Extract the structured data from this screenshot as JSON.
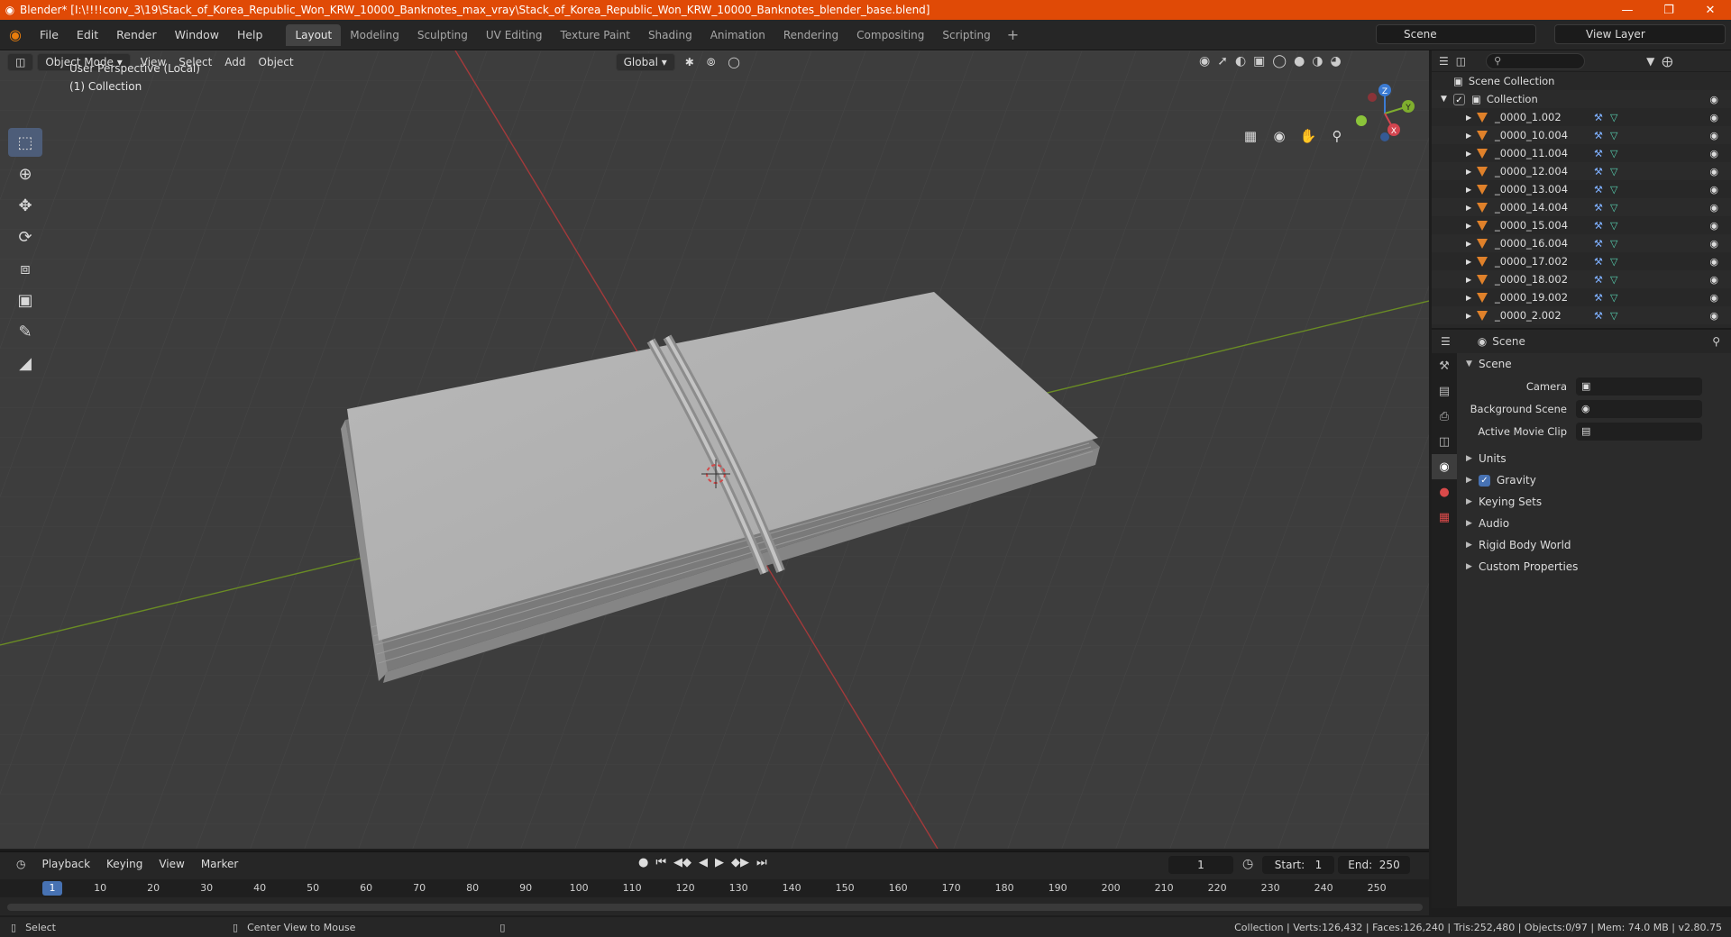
{
  "window": {
    "title": "Blender* [I:\\!!!!conv_3\\19\\Stack_of_Korea_Republic_Won_KRW_10000_Banknotes_max_vray\\Stack_of_Korea_Republic_Won_KRW_10000_Banknotes_blender_base.blend]",
    "minimize": "—",
    "maximize": "❐",
    "close": "✕"
  },
  "menu": [
    "File",
    "Edit",
    "Render",
    "Window",
    "Help"
  ],
  "workspaces": [
    "Layout",
    "Modeling",
    "Sculpting",
    "UV Editing",
    "Texture Paint",
    "Shading",
    "Animation",
    "Rendering",
    "Compositing",
    "Scripting"
  ],
  "workspace_add": "+",
  "scene_selector": "Scene",
  "view_layer": "View Layer",
  "viewport": {
    "mode": "Object Mode",
    "menus": [
      "View",
      "Select",
      "Add",
      "Object"
    ],
    "transform_orientation": "Global",
    "info_line1": "User Perspective (Local)",
    "info_line2": "(1) Collection",
    "gizmo_axes": {
      "x": "X",
      "y": "Y",
      "z": "Z"
    }
  },
  "outliner": {
    "root": "Scene Collection",
    "collection": "Collection",
    "objects": [
      "_0000_1.002",
      "_0000_10.004",
      "_0000_11.004",
      "_0000_12.004",
      "_0000_13.004",
      "_0000_14.004",
      "_0000_15.004",
      "_0000_16.004",
      "_0000_17.002",
      "_0000_18.002",
      "_0000_19.002",
      "_0000_2.002"
    ]
  },
  "properties": {
    "header": "Scene",
    "section": "Scene",
    "fields": [
      {
        "label": "Camera",
        "value": ""
      },
      {
        "label": "Background Scene",
        "value": ""
      },
      {
        "label": "Active Movie Clip",
        "value": ""
      }
    ],
    "panels": [
      "Units",
      "Gravity",
      "Keying Sets",
      "Audio",
      "Rigid Body World",
      "Custom Properties"
    ],
    "gravity_checked": true
  },
  "timeline": {
    "menus": [
      "Playback",
      "Keying",
      "View",
      "Marker"
    ],
    "current_frame": "1",
    "start_label": "Start:",
    "start": "1",
    "end_label": "End:",
    "end": "250",
    "ticks": [
      "10",
      "20",
      "30",
      "40",
      "50",
      "60",
      "70",
      "80",
      "90",
      "100",
      "110",
      "120",
      "130",
      "140",
      "150",
      "160",
      "170",
      "180",
      "190",
      "200",
      "210",
      "220",
      "230",
      "240",
      "250"
    ]
  },
  "status": {
    "left": "Select",
    "middle": "Center View to Mouse",
    "right": "Collection | Verts:126,432 | Faces:126,240 | Tris:252,480 | Objects:0/97 | Mem: 74.0 MB | v2.80.75"
  },
  "colors": {
    "accent": "#4772b3",
    "titlebar": "#e04a06",
    "x_axis": "#c0393b",
    "y_axis": "#7fa82a"
  }
}
